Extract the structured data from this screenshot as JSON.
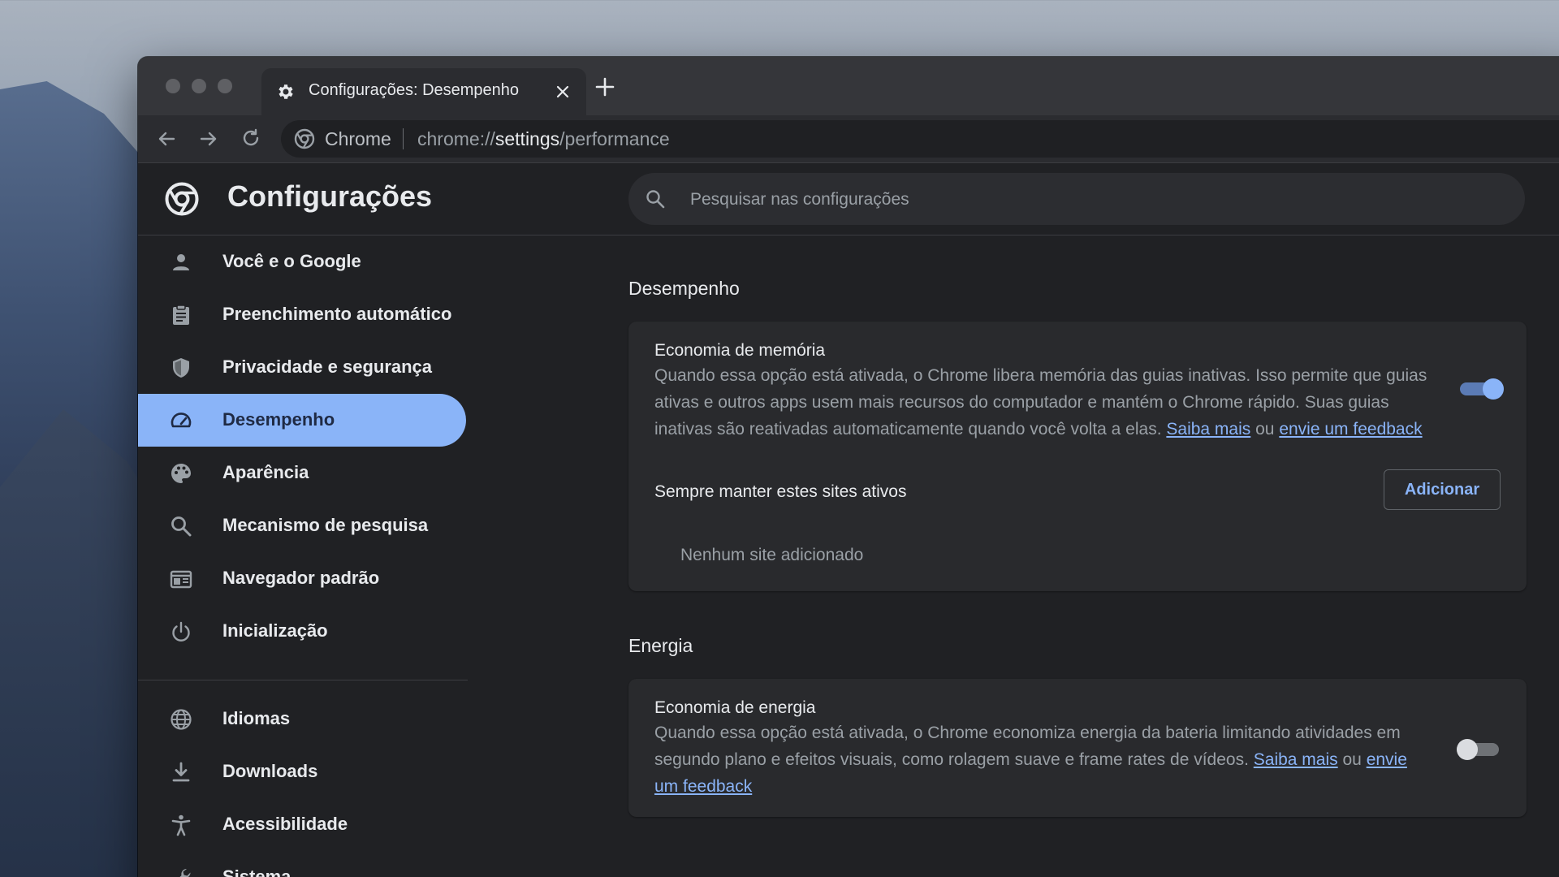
{
  "browser": {
    "tab_title": "Configurações: Desempenho",
    "omnibox": {
      "site_chip": "Chrome",
      "url_prefix": "chrome://",
      "url_host": "settings",
      "url_path": "/performance"
    }
  },
  "settings": {
    "title": "Configurações",
    "search_placeholder": "Pesquisar nas configurações"
  },
  "sidebar": {
    "items": [
      {
        "label": "Você e o Google",
        "icon": "person-icon"
      },
      {
        "label": "Preenchimento automático",
        "icon": "clipboard-icon"
      },
      {
        "label": "Privacidade e segurança",
        "icon": "shield-icon"
      },
      {
        "label": "Desempenho",
        "icon": "speedometer-icon",
        "active": true
      },
      {
        "label": "Aparência",
        "icon": "palette-icon"
      },
      {
        "label": "Mecanismo de pesquisa",
        "icon": "search-icon"
      },
      {
        "label": "Navegador padrão",
        "icon": "browser-window-icon"
      },
      {
        "label": "Inicialização",
        "icon": "power-icon"
      },
      {
        "label": "Idiomas",
        "icon": "globe-icon"
      },
      {
        "label": "Downloads",
        "icon": "download-icon"
      },
      {
        "label": "Acessibilidade",
        "icon": "accessibility-icon"
      },
      {
        "label": "Sistema",
        "icon": "wrench-icon"
      }
    ]
  },
  "performance": {
    "section_title": "Desempenho",
    "memory_saver": {
      "title": "Economia de memória",
      "description": "Quando essa opção está ativada, o Chrome libera memória das guias inativas. Isso permite que guias ativas e outros apps usem mais recursos do computador e mantém o Chrome rápido. Suas guias inativas são reativadas automaticamente quando você volta a elas.",
      "learn_more": "Saiba mais",
      "or": "ou",
      "feedback": "envie um feedback",
      "enabled": true
    },
    "always_active": {
      "title": "Sempre manter estes sites ativos",
      "add_button": "Adicionar",
      "empty_text": "Nenhum site adicionado"
    }
  },
  "energy": {
    "section_title": "Energia",
    "energy_saver": {
      "title": "Economia de energia",
      "description": "Quando essa opção está ativada, o Chrome economiza energia da bateria limitando atividades em segundo plano e efeitos visuais, como rolagem suave e frame rates de vídeos.",
      "learn_more": "Saiba mais",
      "or": "ou",
      "feedback": "envie um feedback",
      "enabled": false
    }
  },
  "colors": {
    "accent": "#8ab4f8",
    "background": "#202124",
    "card": "#292a2d",
    "text_primary": "#e8eaed",
    "text_secondary": "#9aa0a6"
  }
}
